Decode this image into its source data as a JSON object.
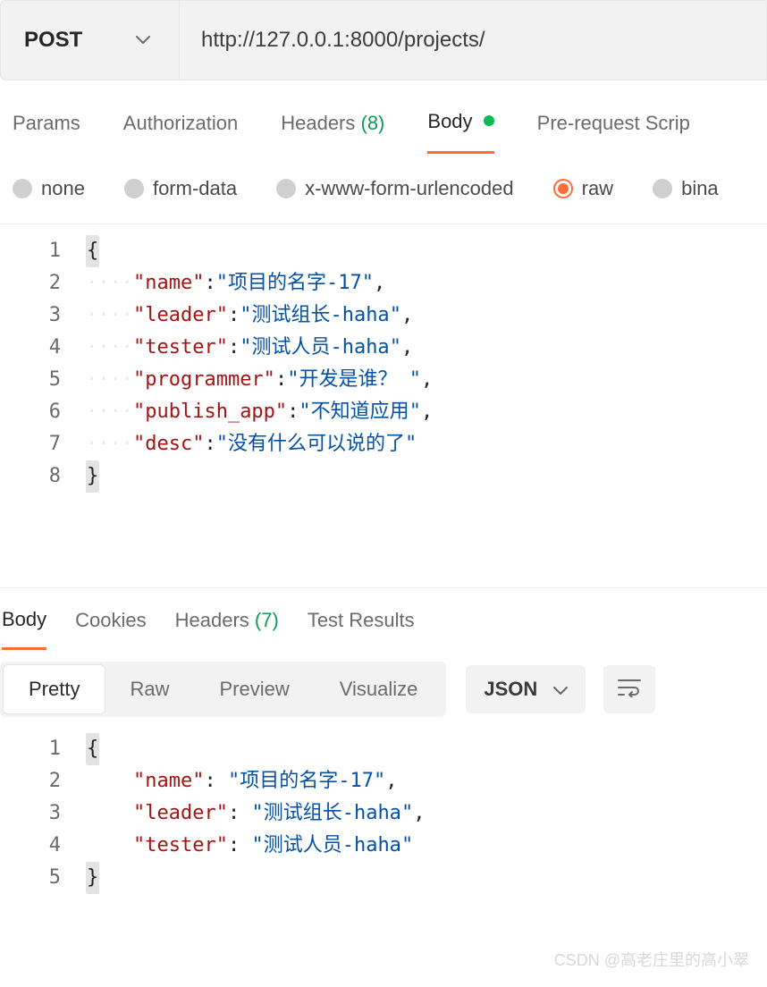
{
  "request": {
    "method": "POST",
    "url": "http://127.0.0.1:8000/projects/"
  },
  "request_tabs": {
    "params": "Params",
    "authorization": "Authorization",
    "headers_label": "Headers",
    "headers_count": "(8)",
    "body": "Body",
    "prerequest": "Pre-request Scrip"
  },
  "body_types": {
    "none": "none",
    "form_data": "form-data",
    "x_www": "x-www-form-urlencoded",
    "raw": "raw",
    "binary": "bina"
  },
  "request_body": {
    "lines": [
      "1",
      "2",
      "3",
      "4",
      "5",
      "6",
      "7",
      "8"
    ],
    "json": {
      "name": "项目的名字-17",
      "leader": "测试组长-haha",
      "tester": "测试人员-haha",
      "programmer": "开发是谁？ ",
      "publish_app": "不知道应用",
      "desc": "没有什么可以说的了"
    }
  },
  "response_tabs": {
    "body": "Body",
    "cookies": "Cookies",
    "headers_label": "Headers",
    "headers_count": "(7)",
    "test_results": "Test Results"
  },
  "view_modes": {
    "pretty": "Pretty",
    "raw": "Raw",
    "preview": "Preview",
    "visualize": "Visualize"
  },
  "format_select": "JSON",
  "response_body": {
    "lines": [
      "1",
      "2",
      "3",
      "4",
      "5"
    ],
    "json": {
      "name": "项目的名字-17",
      "leader": "测试组长-haha",
      "tester": "测试人员-haha"
    }
  },
  "watermark": "CSDN @高老庄里的高小翠"
}
